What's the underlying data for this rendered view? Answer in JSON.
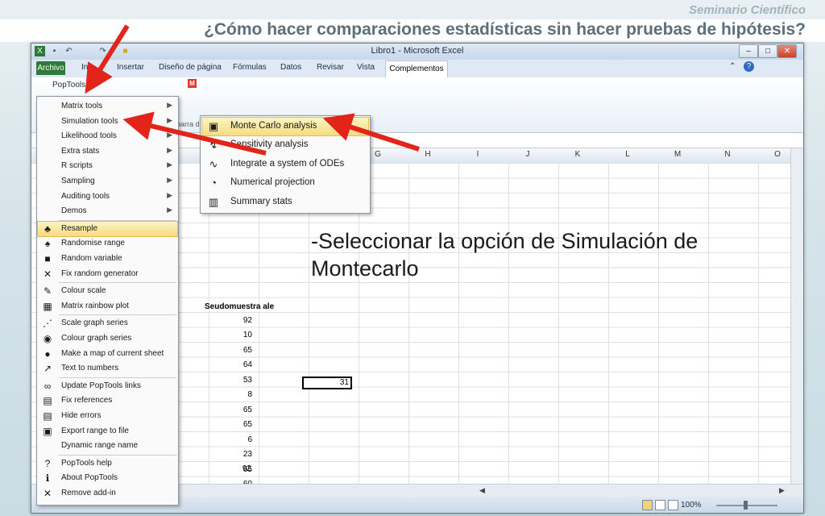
{
  "slide": {
    "seminar": "Seminario Científico",
    "title": "¿Cómo hacer comparaciones estadísticas sin hacer pruebas de hipótesis?",
    "instruction_line1": "-Seleccionar la opción de Simulación de",
    "instruction_line2": "Montecarlo"
  },
  "excel": {
    "window_title": "Libro1 - Microsoft Excel",
    "tabs": [
      "Archivo",
      "In",
      "Insertar",
      "Diseño de página",
      "Fórmulas",
      "Datos",
      "Revisar",
      "Vista",
      "Complementos"
    ],
    "poptools_button": "PopTools ▾",
    "toolbar_label": "barra d",
    "columns": [
      "G",
      "H",
      "I",
      "J",
      "K",
      "L",
      "M",
      "N",
      "O"
    ],
    "sample_header": "Seudomuestra ale",
    "sample_values": [
      "92",
      "10",
      "65",
      "64",
      "53",
      "8",
      "65",
      "65",
      "6",
      "23",
      "65",
      "60",
      "92"
    ],
    "active_cell_value": "31",
    "zoom": "100%"
  },
  "poptools_menu": [
    {
      "label": "Matrix tools",
      "icon": "",
      "submenu": true
    },
    {
      "label": "Simulation tools",
      "icon": "",
      "submenu": true
    },
    {
      "label": "Likelihood tools",
      "icon": "",
      "submenu": true
    },
    {
      "label": "Extra stats",
      "icon": "",
      "submenu": true
    },
    {
      "label": "R scripts",
      "icon": "",
      "submenu": true
    },
    {
      "label": "Sampling",
      "icon": "",
      "submenu": true
    },
    {
      "label": "Auditing tools",
      "icon": "",
      "submenu": true
    },
    {
      "label": "Demos",
      "icon": "",
      "submenu": true
    },
    {
      "label": "Resample",
      "icon": "♣",
      "submenu": false
    },
    {
      "label": "Randomise range",
      "icon": "♠",
      "submenu": false
    },
    {
      "label": "Random variable",
      "icon": "■",
      "submenu": false
    },
    {
      "label": "Fix random generator",
      "icon": "✕",
      "submenu": false
    },
    {
      "label": "Colour scale",
      "icon": "✎",
      "submenu": false
    },
    {
      "label": "Matrix rainbow plot",
      "icon": "▦",
      "submenu": false
    },
    {
      "label": "Scale graph series",
      "icon": "⋰",
      "submenu": false
    },
    {
      "label": "Colour graph series",
      "icon": "◉",
      "submenu": false
    },
    {
      "label": "Make a map of current sheet",
      "icon": "●",
      "submenu": false
    },
    {
      "label": "Text to numbers",
      "icon": "↗",
      "submenu": false
    },
    {
      "label": "Update PopTools links",
      "icon": "∞",
      "submenu": false
    },
    {
      "label": "Fix references",
      "icon": "▤",
      "submenu": false
    },
    {
      "label": "Hide errors",
      "icon": "▤",
      "submenu": false
    },
    {
      "label": "Export range to file",
      "icon": "▣",
      "submenu": false
    },
    {
      "label": "Dynamic range name",
      "icon": "",
      "submenu": false
    },
    {
      "label": "PopTools help",
      "icon": "?",
      "submenu": false
    },
    {
      "label": "About PopTools",
      "icon": "ℹ",
      "submenu": false
    },
    {
      "label": "Remove add-in",
      "icon": "✕",
      "submenu": false
    }
  ],
  "simulation_submenu": [
    {
      "label": "Monte Carlo analysis",
      "icon": "▣"
    },
    {
      "label": "Sensitivity analysis",
      "icon": "↯"
    },
    {
      "label": "Integrate a system of ODEs",
      "icon": "∿"
    },
    {
      "label": "Numerical projection",
      "icon": "◔"
    },
    {
      "label": "Summary stats",
      "icon": "▥"
    }
  ],
  "colors": {
    "arrow": "#e3241b",
    "highlight": "#f6dc80",
    "excel_green": "#2b7a36"
  }
}
